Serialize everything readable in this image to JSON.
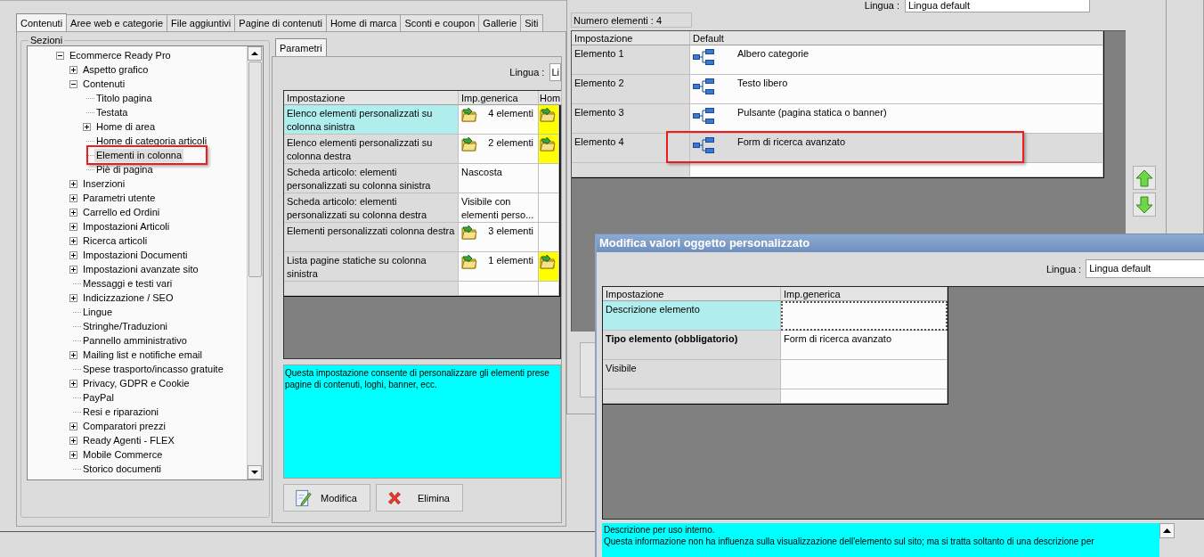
{
  "main_window": {
    "tabs": [
      {
        "label": "Contenuti",
        "selected": true
      },
      {
        "label": "Aree web e categorie",
        "selected": false
      },
      {
        "label": "File aggiuntivi",
        "selected": false
      },
      {
        "label": "Pagine di contenuti",
        "selected": false
      },
      {
        "label": "Home di marca",
        "selected": false
      },
      {
        "label": "Sconti e coupon",
        "selected": false
      },
      {
        "label": "Gallerie",
        "selected": false
      },
      {
        "label": "Siti",
        "selected": false
      }
    ],
    "sections": {
      "title": "Sezioni",
      "tree": [
        {
          "label": "Ecommerce Ready Pro",
          "expanded": true,
          "selected": false,
          "children": [
            {
              "label": "Aspetto grafico",
              "expanded": false,
              "selected": false
            },
            {
              "label": "Contenuti",
              "expanded": true,
              "selected": false,
              "children": [
                {
                  "label": "Titolo pagina",
                  "selected": false
                },
                {
                  "label": "Testata",
                  "selected": false
                },
                {
                  "label": "Home di area",
                  "expanded": false,
                  "selected": false
                },
                {
                  "label": "Home di categoria articoli",
                  "selected": false
                },
                {
                  "label": "Elementi in colonna",
                  "selected": true
                },
                {
                  "label": "Piè di pagina",
                  "selected": false
                }
              ]
            },
            {
              "label": "Inserzioni",
              "expanded": false,
              "selected": false
            },
            {
              "label": "Parametri utente",
              "expanded": false,
              "selected": false
            },
            {
              "label": "Carrello ed Ordini",
              "expanded": false,
              "selected": false
            },
            {
              "label": "Impostazioni Articoli",
              "expanded": false,
              "selected": false
            },
            {
              "label": "Ricerca articoli",
              "expanded": false,
              "selected": false
            },
            {
              "label": "Impostazioni Documenti",
              "expanded": false,
              "selected": false
            },
            {
              "label": "Impostazioni avanzate sito",
              "expanded": false,
              "selected": false
            },
            {
              "label": "Messaggi e testi vari",
              "selected": false
            },
            {
              "label": "Indicizzazione / SEO",
              "expanded": false,
              "selected": false
            },
            {
              "label": "Lingue",
              "selected": false
            },
            {
              "label": "Stringhe/Traduzioni",
              "selected": false
            },
            {
              "label": "Pannello amministrativo",
              "selected": false
            },
            {
              "label": "Mailing list e notifiche email",
              "expanded": false,
              "selected": false
            },
            {
              "label": "Spese trasporto/incasso gratuite",
              "selected": false
            },
            {
              "label": "Privacy, GDPR e Cookie",
              "expanded": false,
              "selected": false
            },
            {
              "label": "PayPal",
              "selected": false
            },
            {
              "label": "Resi e riparazioni",
              "selected": false
            },
            {
              "label": "Comparatori prezzi",
              "expanded": false,
              "selected": false
            },
            {
              "label": "Ready Agenti - FLEX",
              "expanded": false,
              "selected": false
            },
            {
              "label": "Mobile Commerce",
              "expanded": false,
              "selected": false
            },
            {
              "label": "Storico documenti",
              "selected": false
            }
          ]
        }
      ]
    },
    "panel_tabs": [
      {
        "label": "Parametri",
        "selected": true
      }
    ],
    "language": {
      "label": "Lingua :",
      "value": "Li"
    },
    "table": {
      "columns": [
        "Impostazione",
        "Imp.generica",
        "Hom"
      ],
      "rows": [
        {
          "setting": "Elenco elementi personalizzati su colonna sinistra",
          "generic": "4 elementi",
          "kind": "list",
          "column_3_set": true,
          "selected": true
        },
        {
          "setting": "Elenco elementi personalizzati su colonna destra",
          "generic": "2 elementi",
          "kind": "list",
          "column_3_set": true,
          "selected": false
        },
        {
          "setting": "Scheda articolo: elementi personalizzati su colonna sinistra",
          "generic": "Nascosta",
          "kind": "text",
          "column_3_set": false,
          "selected": false
        },
        {
          "setting": "Scheda articolo: elementi personalizzati su colonna destra",
          "generic": "Visibile con elementi perso...",
          "kind": "text",
          "column_3_set": false,
          "selected": false
        },
        {
          "setting": "Elementi personalizzati colonna destra",
          "generic": "3 elementi",
          "kind": "list",
          "column_3_set": false,
          "selected": false
        },
        {
          "setting": "Lista pagine statiche su colonna sinistra",
          "generic": "1 elementi",
          "kind": "list",
          "column_3_set": true,
          "selected": false
        }
      ]
    },
    "description": "Questa impostazione consente di personalizzare gli elementi prese\npagine di contenuti, loghi, banner, ecc.",
    "buttons": [
      {
        "label": "Modifica",
        "kind": "edit"
      },
      {
        "label": "Elimina",
        "kind": "delete"
      }
    ]
  },
  "elements_window": {
    "language": {
      "label": "Lingua :",
      "value": "Lingua default"
    },
    "count": "Numero elementi : 4",
    "table": {
      "columns": [
        "Impostazione",
        "Default"
      ],
      "rows": [
        {
          "setting": "Elemento 1",
          "value": "Albero categorie",
          "selected": false
        },
        {
          "setting": "Elemento 2",
          "value": "Testo libero",
          "selected": false
        },
        {
          "setting": "Elemento 3",
          "value": "Pulsante (pagina statica o banner)",
          "selected": false
        },
        {
          "setting": "Elemento 4",
          "value": "Form di ricerca avanzato",
          "selected": true
        }
      ]
    }
  },
  "dialog": {
    "title": "Modifica valori oggetto personalizzato",
    "language": {
      "label": "Lingua :",
      "value": "Lingua default"
    },
    "table": {
      "columns": [
        "Impostazione",
        "Imp.generica"
      ],
      "rows": [
        {
          "setting": "Descrizione elemento",
          "selected": true,
          "required": false
        },
        {
          "setting": "Tipo elemento (obbligatorio)",
          "value": "Form di ricerca avanzato",
          "selected": false,
          "required": true
        },
        {
          "setting": "Visibile",
          "selected": false,
          "required": false
        }
      ]
    },
    "description": "Descrizione per uso interno.\nQuesta informazione non ha influenza sulla visualizzazione dell'elemento sul sito; ma si tratta soltanto di una descrizione per"
  }
}
